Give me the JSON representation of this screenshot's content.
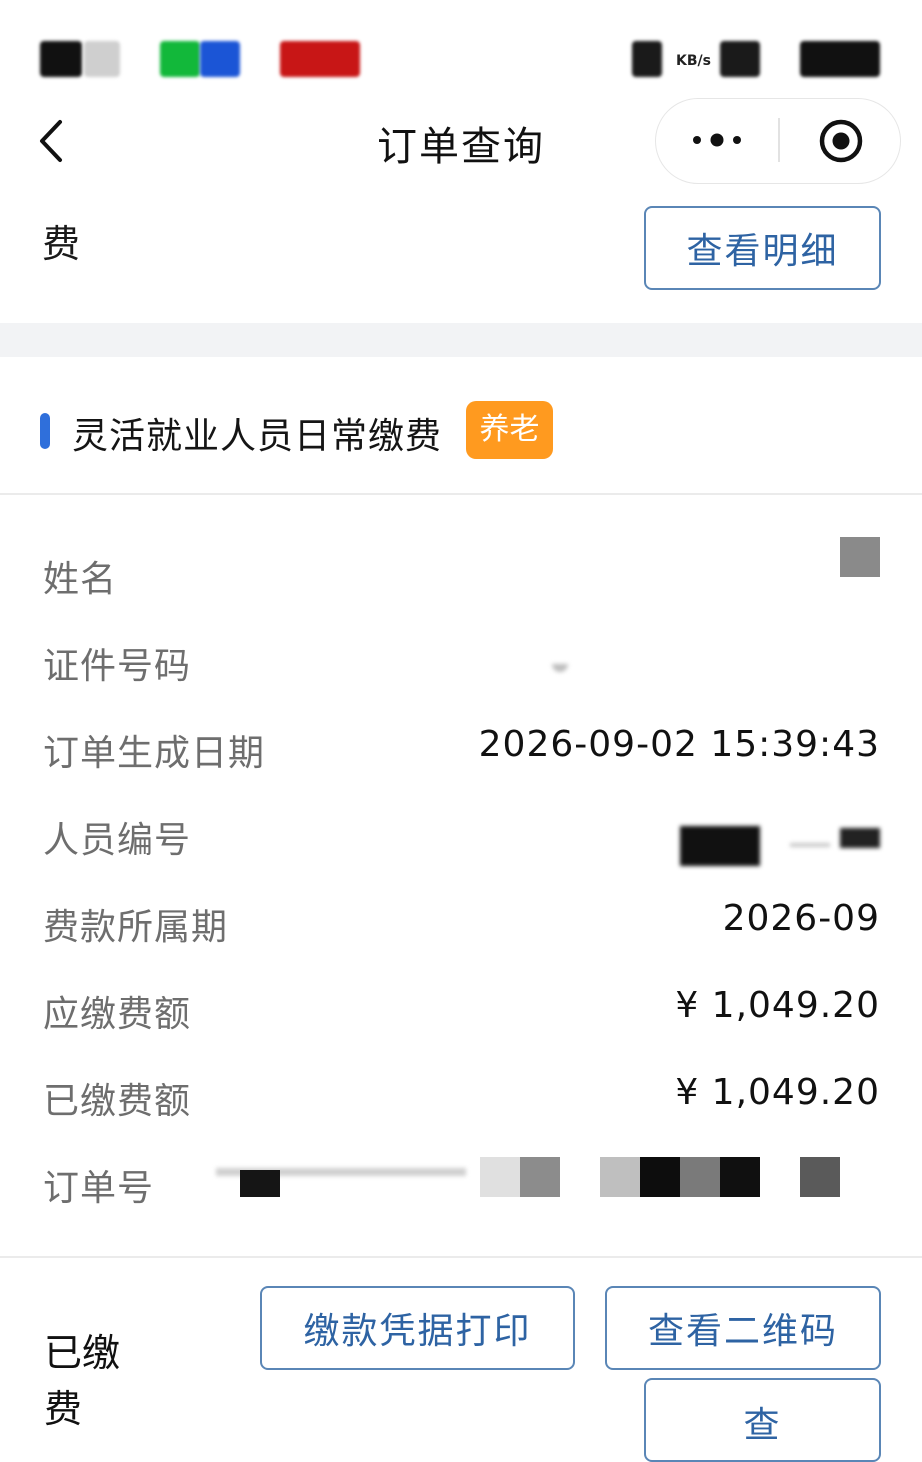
{
  "status_bar": {
    "network_speed_unit": "KB/s"
  },
  "nav": {
    "title": "订单查询",
    "more_icon": "more-dots-icon",
    "close_icon": "target-circle-icon"
  },
  "top_section": {
    "status_text": "费",
    "detail_button": "查看明细"
  },
  "section": {
    "title": "灵活就业人员日常缴费",
    "tag": "养老",
    "accent_color": "#2f6fdb",
    "tag_color": "#ff9a1f"
  },
  "fields": [
    {
      "label": "姓名",
      "value": ""
    },
    {
      "label": "证件号码",
      "value": ""
    },
    {
      "label": "订单生成日期",
      "value": "2026-09-02 15:39:43"
    },
    {
      "label": "人员编号",
      "value": ""
    },
    {
      "label": "费款所属期",
      "value": "2026-09"
    },
    {
      "label": "应缴费额",
      "value": "¥ 1,049.20"
    },
    {
      "label": "已缴费额",
      "value": "¥ 1,049.20"
    },
    {
      "label": "订单号",
      "value": ""
    }
  ],
  "bottom": {
    "status_text": "已缴费",
    "print_button": "缴款凭据打印",
    "qr_button": "查看二维码",
    "partial_button": "查"
  }
}
